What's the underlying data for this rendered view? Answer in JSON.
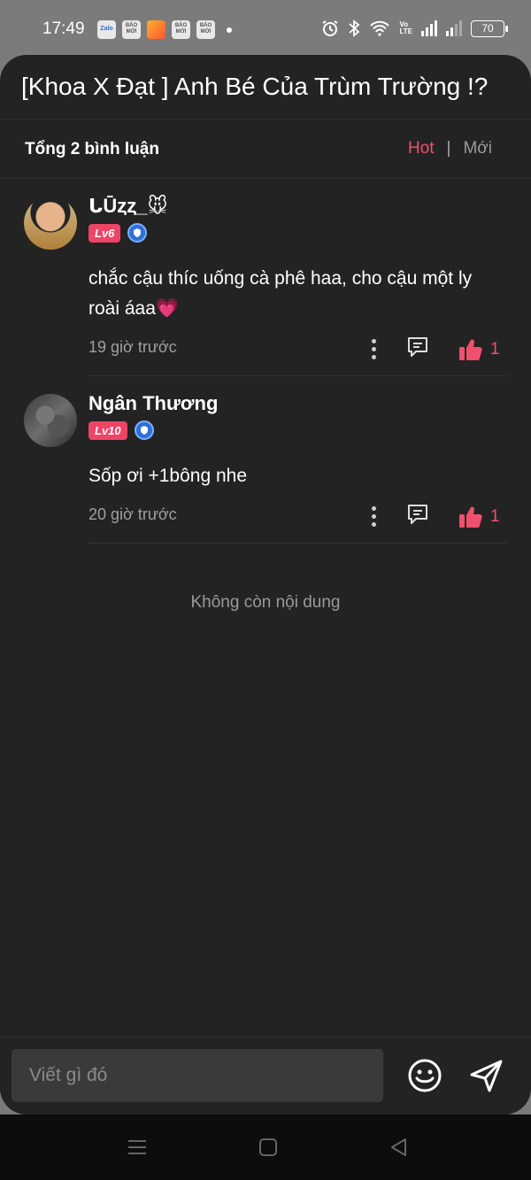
{
  "status_bar": {
    "time": "17:49",
    "notification_icons": [
      "zalo-icon",
      "bao-moi-icon",
      "game-icon",
      "bao-moi-icon",
      "bao-moi-icon"
    ],
    "notification_labels": {
      "zalo": "Zalo",
      "bao_moi": "BÁO MỚI"
    },
    "volte_label": "Vo\nLTE",
    "battery": "70"
  },
  "header": {
    "title": "[Khoa X Đạt ] Anh Bé Của Trùm Trường !?"
  },
  "subbar": {
    "count": "Tổng 2 bình luận",
    "sort_hot": "Hot",
    "sort_sep": "|",
    "sort_new": "Mới"
  },
  "comments": [
    {
      "username": "ᒐŪȥȥ_🐭",
      "level": "Lv6",
      "text": "chắc cậu thíc uống cà phê haa, cho cậu một ly roài áaa💗",
      "time": "19 giờ trước",
      "likes": "1"
    },
    {
      "username": "Ngân Thương",
      "level": "Lv10",
      "text": "Sốp ơi +1bông nhe",
      "time": "20 giờ trước",
      "likes": "1"
    }
  ],
  "end_text": "Không còn nội dung",
  "input": {
    "placeholder": "Viết gì đó"
  },
  "colors": {
    "accent": "#f0506e",
    "background": "#232323",
    "level_badge": "#ee4466",
    "verified_badge": "#2f6fd8"
  }
}
